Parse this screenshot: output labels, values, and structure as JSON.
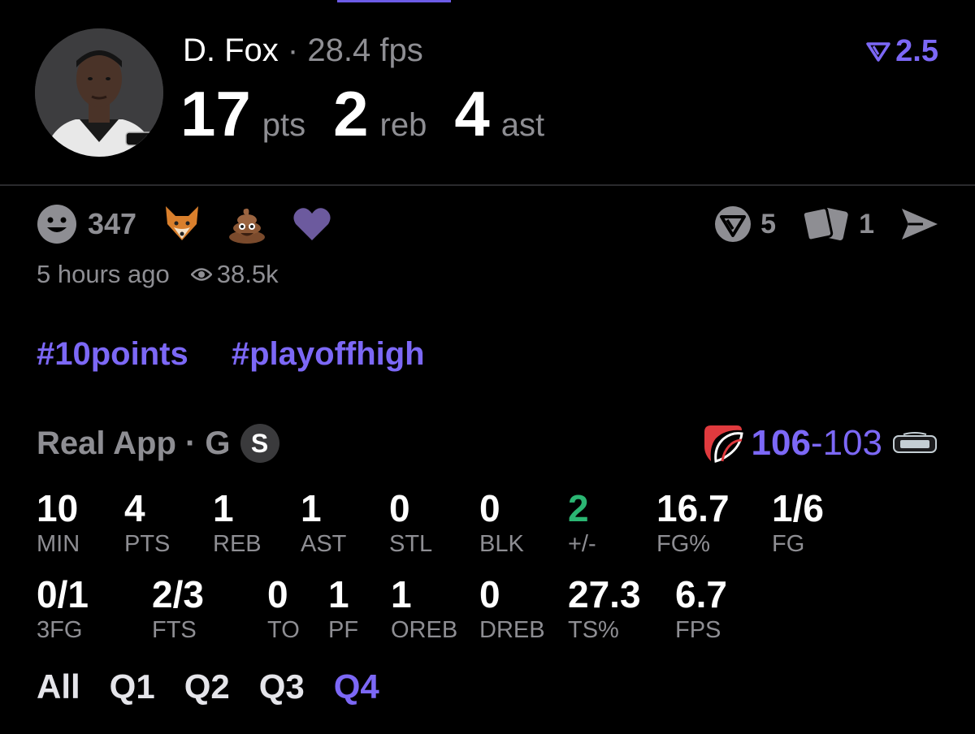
{
  "post": {
    "player_name": "D. Fox",
    "separator": "·",
    "fps_label": "28.4 fps",
    "stats": [
      {
        "value": "17",
        "unit": "pts"
      },
      {
        "value": "2",
        "unit": "reb"
      },
      {
        "value": "4",
        "unit": "ast"
      }
    ],
    "badge_value": "2.5",
    "reactions": {
      "smile_count": "347"
    },
    "actions": {
      "shot_count": "5",
      "cards_count": "1"
    },
    "time_ago": "5 hours ago",
    "views": "38.5k",
    "hashtags": [
      "#10points",
      "#playoffhigh"
    ]
  },
  "game": {
    "app_label": "Real App · G",
    "position_badge": "S",
    "score_home": "106",
    "score_dash": "-",
    "score_away": "103"
  },
  "stats_row1": [
    {
      "value": "10",
      "label": "MIN"
    },
    {
      "value": "4",
      "label": "PTS"
    },
    {
      "value": "1",
      "label": "REB"
    },
    {
      "value": "1",
      "label": "AST"
    },
    {
      "value": "0",
      "label": "STL"
    },
    {
      "value": "0",
      "label": "BLK"
    },
    {
      "value": "2",
      "label": "+/-"
    },
    {
      "value": "16.7",
      "label": "FG%"
    },
    {
      "value": "1/6",
      "label": "FG"
    }
  ],
  "stats_row2": [
    {
      "value": "0/1",
      "label": "3FG"
    },
    {
      "value": "2/3",
      "label": "FTS"
    },
    {
      "value": "0",
      "label": "TO"
    },
    {
      "value": "1",
      "label": "PF"
    },
    {
      "value": "1",
      "label": "OREB"
    },
    {
      "value": "0",
      "label": "DREB"
    },
    {
      "value": "27.3",
      "label": "TS%"
    },
    {
      "value": "6.7",
      "label": "FPS"
    }
  ],
  "quarters": [
    "All",
    "Q1",
    "Q2",
    "Q3",
    "Q4"
  ],
  "active_quarter": "Q4",
  "colors": {
    "accent": "#7c68f6",
    "positive": "#2bb673",
    "muted": "#8e8e93"
  },
  "icons": [
    "smile-icon",
    "fox-emoji-icon",
    "poop-emoji-icon",
    "heart-icon",
    "shot-icon",
    "cards-icon",
    "share-icon",
    "eye-icon",
    "real-badge-icon",
    "blazers-logo-icon",
    "spurs-logo-icon"
  ]
}
